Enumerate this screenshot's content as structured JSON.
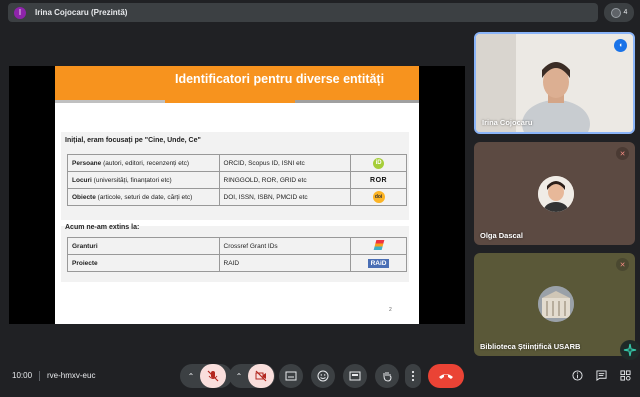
{
  "header": {
    "presenter_initial": "I",
    "presenter_text": "Irina Cojocaru (Prezintă)",
    "participants_count": "4"
  },
  "slide": {
    "title": "Identificatori pentru diverse entități",
    "section1_title": "Inițial, eram focusați pe \"Cine, Unde, Ce\"",
    "rows1": [
      {
        "bold": "Persoane",
        "rest": " (autori, editori, recenzenți etc)",
        "ids": "ORCID, Scopus ID, ISNI etc",
        "logo": "iD"
      },
      {
        "bold": "Locuri",
        "rest": " (universități, finanțatori etc)",
        "ids": "RINGGOLD, ROR, GRID etc",
        "logo": "ROR"
      },
      {
        "bold": "Obiecte",
        "rest": " (articole, seturi de date, cărți etc)",
        "ids": "DOI, ISSN, ISBN, PMCID etc",
        "logo": "doi"
      }
    ],
    "section2_title": "Acum ne-am extins la:",
    "rows2": [
      {
        "bold": "Granturi",
        "ids": "Crossref Grant IDs"
      },
      {
        "bold": "Proiecte",
        "ids": "RAID",
        "logo": "RAiD"
      }
    ],
    "page_number": "2"
  },
  "participants": [
    {
      "name": "Irina Cojocaru"
    },
    {
      "name": "Olga Dascal"
    },
    {
      "name": "Biblioteca Științifică USARB"
    }
  ],
  "footer": {
    "time": "10:00",
    "meeting_code": "rve-hmxv-euc"
  },
  "colors": {
    "accent_orange": "#f7931e",
    "end_call_red": "#ea4335",
    "muted_red": "#f28b82",
    "toolbar_gray": "#3c4043"
  }
}
